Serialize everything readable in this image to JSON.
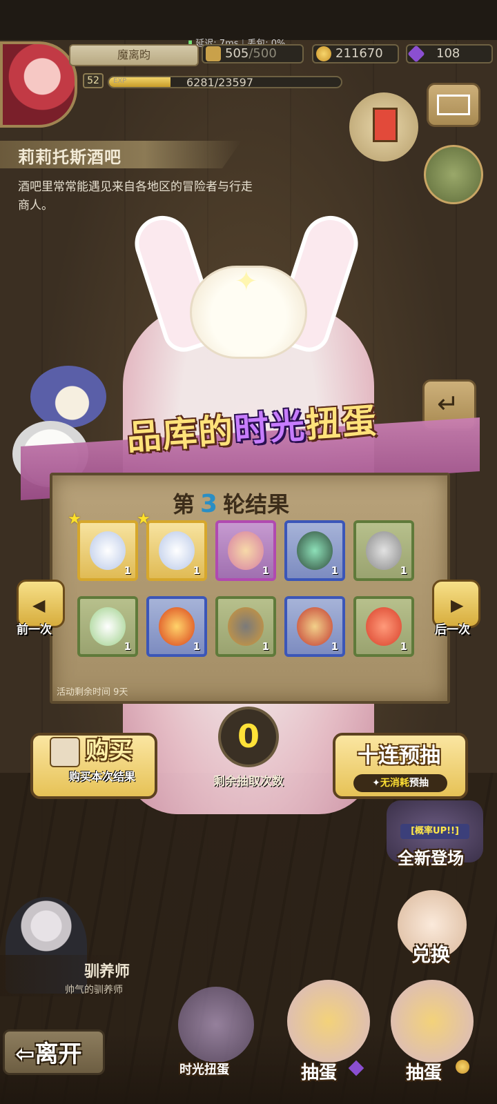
{
  "status": {
    "latency": "延迟: 7ms",
    "packet_loss": "丢包: 0%"
  },
  "player": {
    "name": "魔离昀",
    "stamina": "505",
    "stamina_max": "/500",
    "gold": "211670",
    "gems": "108",
    "level": "52",
    "exp_label": "EXP",
    "exp": "6281/23597",
    "exp_fraction": 0.266
  },
  "location": {
    "title": "莉莉托斯酒吧",
    "description": "酒吧里常常能遇见来自各地区的冒险者与行走商人。"
  },
  "gacha": {
    "title_pre": "品库的",
    "title_hl": "时光",
    "title_post": "扭蛋",
    "round_prefix": "第",
    "round_number": "3",
    "round_suffix": "轮结果",
    "remaining_time": "活动剩余时间 9天",
    "prev_label": "前一次",
    "next_label": "后一次",
    "remaining_draws": "0",
    "remaining_draws_label": "剩余抽取次数",
    "buy_title": "购买",
    "buy_sub": "购买本次结果",
    "ten_title": "十连预抽",
    "ten_sub_hl": "无消耗",
    "ten_sub": "预抽",
    "items": [
      {
        "name": "white-crystal-egg",
        "qty": "1",
        "rarity": "gold",
        "starred": true
      },
      {
        "name": "white-crystal-egg",
        "qty": "1",
        "rarity": "gold",
        "starred": true
      },
      {
        "name": "pink-nest-egg",
        "qty": "1",
        "rarity": "purple",
        "starred": false
      },
      {
        "name": "green-armor-egg",
        "qty": "1",
        "rarity": "blue",
        "starred": false
      },
      {
        "name": "grey-owl-egg",
        "qty": "1",
        "rarity": "green",
        "starred": false
      },
      {
        "name": "white-radish",
        "qty": "1",
        "rarity": "green",
        "starred": false
      },
      {
        "name": "fire-swirl-egg",
        "qty": "1",
        "rarity": "blue",
        "starred": false
      },
      {
        "name": "iron-helmet",
        "qty": "1",
        "rarity": "green",
        "starred": false
      },
      {
        "name": "red-feather-egg",
        "qty": "1",
        "rarity": "blue",
        "starred": false
      },
      {
        "name": "red-crab",
        "qty": "1",
        "rarity": "green",
        "starred": false
      }
    ]
  },
  "side": {
    "event_tag": "[概率UP!!]",
    "event_label": "全新登场",
    "exchange_label": "兑换"
  },
  "bottom": {
    "tamer_name": "驯养师",
    "tamer_title": "帅气的驯养师",
    "leave": "离开",
    "tab_time_gacha": "时光扭蛋",
    "tab_draw_gem": "抽蛋",
    "tab_draw_gold": "抽蛋"
  },
  "colors": {
    "gold": "#d6a72c",
    "purple": "#b04ab0",
    "blue": "#3b56b8",
    "green": "#5f7a3a"
  }
}
